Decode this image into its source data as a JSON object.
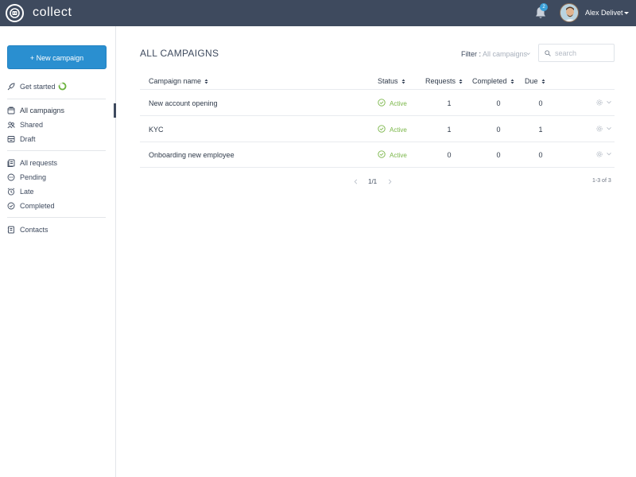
{
  "app": {
    "brand": "collect",
    "notification_count": "2",
    "user_name": "Alex Delivet"
  },
  "sidebar": {
    "new_campaign_label": "+ New campaign",
    "get_started": "Get started",
    "groups": [
      [
        "All campaigns",
        "Shared",
        "Draft"
      ],
      [
        "All requests",
        "Pending",
        "Late",
        "Completed"
      ],
      [
        "Contacts"
      ]
    ],
    "active_item": "All campaigns"
  },
  "main": {
    "title": "ALL CAMPAIGNS",
    "filter_label": "Filter :",
    "filter_value": "All campaigns",
    "search_placeholder": "search",
    "columns": [
      "Campaign name",
      "Status",
      "Requests",
      "Completed",
      "Due"
    ],
    "rows": [
      {
        "name": "New account opening",
        "status": "Active",
        "requests": "1",
        "completed": "0",
        "due": "0"
      },
      {
        "name": "KYC",
        "status": "Active",
        "requests": "1",
        "completed": "0",
        "due": "1"
      },
      {
        "name": "Onboarding new employee",
        "status": "Active",
        "requests": "0",
        "completed": "0",
        "due": "0"
      }
    ],
    "pagination": {
      "page": "1/1",
      "count": "1-3 of 3"
    }
  },
  "colors": {
    "topbar": "#3e4a5e",
    "primary_button": "#2a8fd0",
    "status_active": "#7ab648"
  },
  "icons": [
    "logo-icon",
    "bell-icon",
    "rocket-icon",
    "folder-icon",
    "users-icon",
    "draft-icon",
    "requests-icon",
    "pending-icon",
    "clock-icon",
    "check-circle-icon",
    "contacts-icon",
    "search-icon",
    "gear-icon",
    "chevron-down-icon",
    "chevron-left-icon",
    "chevron-right-icon",
    "sort-icon"
  ]
}
